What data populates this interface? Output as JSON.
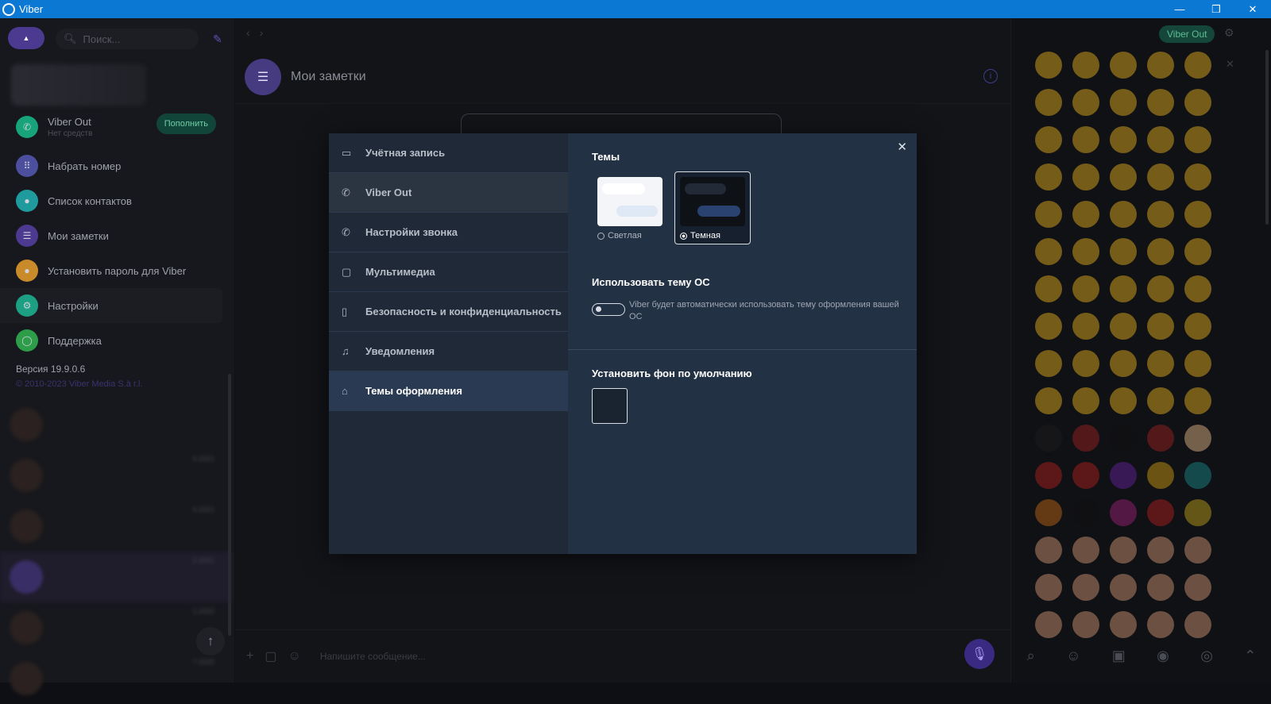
{
  "titlebar": {
    "title": "Viber",
    "minimize": "—",
    "restore": "❐",
    "close": "✕"
  },
  "left": {
    "search_placeholder": "Поиск...",
    "menu": [
      {
        "label": "Viber Out",
        "sub": "Нет средств",
        "icon": "phone-icon",
        "color": "#17a47a"
      },
      {
        "label": "Набрать номер",
        "icon": "dialpad-icon",
        "color": "#4b4f9e"
      },
      {
        "label": "Список контактов",
        "icon": "contacts-icon",
        "color": "#1f9b9e"
      },
      {
        "label": "Мои заметки",
        "icon": "notes-icon",
        "color": "#4b3a8f"
      },
      {
        "label": "Установить пароль для Viber",
        "icon": "lock-icon",
        "color": "#c98a2a"
      },
      {
        "label": "Настройки",
        "icon": "gear-icon",
        "color": "#1d9f84"
      },
      {
        "label": "Поддержка",
        "icon": "support-icon",
        "color": "#2e9d4a"
      }
    ],
    "topup_label": "Пополнить",
    "version": "Версия 19.9.0.6",
    "copyright": "© 2010-2023 Viber Media S.à r.l.",
    "chat_dates": [
      "",
      "5.2021",
      "5.2021",
      "2.2021",
      "1.2020",
      "7.2020"
    ]
  },
  "center": {
    "chat_title": "Мои заметки",
    "composer_placeholder": "Напишите сообщение..."
  },
  "right": {
    "viber_out_label": "Viber Out",
    "emoji_rows": 16,
    "bar_icons": [
      "search-icon",
      "smiley-icon",
      "sticker-icon",
      "sticker-pack-icon",
      "sticker-pack-2-icon",
      "chevron-up-icon"
    ]
  },
  "settings": {
    "nav": [
      {
        "label": "Учётная запись",
        "icon": "account-icon"
      },
      {
        "label": "Viber Out",
        "icon": "viber-out-icon"
      },
      {
        "label": "Настройки звонка",
        "icon": "call-settings-icon"
      },
      {
        "label": "Мультимедиа",
        "icon": "media-icon"
      },
      {
        "label": "Безопасность и конфиденциальность",
        "icon": "lock-icon"
      },
      {
        "label": "Уведомления",
        "icon": "bell-icon"
      },
      {
        "label": "Темы оформления",
        "icon": "brush-icon"
      }
    ],
    "themes_heading": "Темы",
    "theme_light": "Светлая",
    "theme_dark": "Темная",
    "selected_theme": "Темная",
    "os_theme_heading": "Использовать тему ОС",
    "os_theme_desc": "Viber будет автоматически использовать тему оформления вашей ОС",
    "os_theme_enabled": false,
    "bg_heading": "Установить фон по умолчанию",
    "colors": {
      "accent": "#7360f2",
      "modal_bg": "#233144",
      "titlebar": "#0b78d4"
    }
  }
}
